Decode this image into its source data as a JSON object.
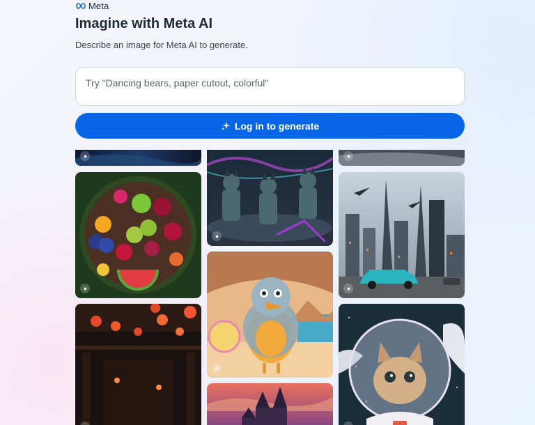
{
  "brand": {
    "name": "Meta",
    "logo_icon": "meta-infinity-logo"
  },
  "header": {
    "title": "Imagine with Meta AI",
    "subtitle": "Describe an image for Meta AI to generate."
  },
  "prompt": {
    "placeholder": "Try \"Dancing bears, paper cutout, colorful\"",
    "value": ""
  },
  "generate_button": {
    "label": "Log in to generate",
    "icon": "sparkle-icon"
  },
  "colors": {
    "accent": "#0866e6",
    "title": "#1c2b33"
  },
  "gallery": {
    "images": [
      {
        "name": "dark-abstract-top-left"
      },
      {
        "name": "fruit-bowl"
      },
      {
        "name": "chinese-lantern-courtyard"
      },
      {
        "name": "neon-cat-warriors"
      },
      {
        "name": "fluffy-bird-beach"
      },
      {
        "name": "fantasy-castle-sunset"
      },
      {
        "name": "grey-abstract-top-right"
      },
      {
        "name": "futuristic-city-car"
      },
      {
        "name": "astronaut-kitten"
      }
    ]
  }
}
